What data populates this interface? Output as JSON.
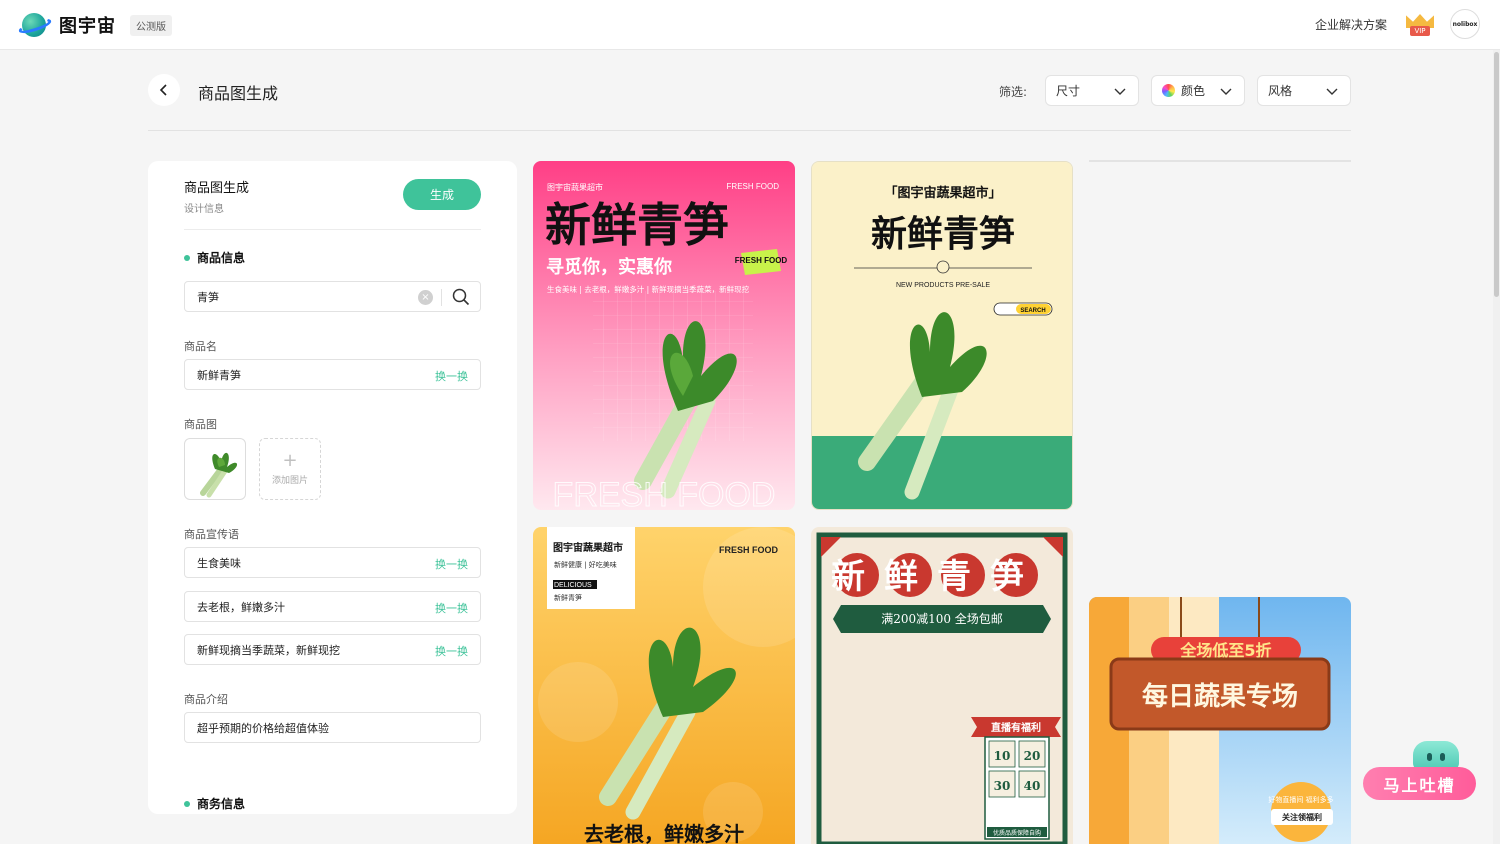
{
  "header": {
    "brand": "图宇宙",
    "beta_badge": "公测版",
    "enterprise_link": "企业解决方案",
    "vip_label": "VIP",
    "avatar_text": "nolibox"
  },
  "page": {
    "title": "商品图生成",
    "filter_label": "筛选:",
    "filters": {
      "size": "尺寸",
      "color": "颜色",
      "style": "风格"
    }
  },
  "form": {
    "title": "商品图生成",
    "subtitle": "设计信息",
    "generate_label": "生成",
    "section_product": "商品信息",
    "search_value": "青笋",
    "name_label": "商品名",
    "name_value": "新鲜青笋",
    "swap_label": "换一换",
    "image_label": "商品图",
    "add_image_label": "添加图片",
    "slogan_label": "商品宣传语",
    "slogans": [
      "生食美味",
      "去老根，鲜嫩多汁",
      "新鲜现摘当季蔬菜，新鲜现挖"
    ],
    "intro_label": "商品介绍",
    "intro_value": "超乎预期的价格给超值体验",
    "section_business": "商务信息"
  },
  "cards": {
    "pink": {
      "store": "图宇宙蔬果超市",
      "fresh": "FRESH FOOD",
      "title": "新鲜青笋",
      "subtitle": "寻觅你，实惠你",
      "badge": "FRESH FOOD",
      "tags": "生食美味 | 去老根，鲜嫩多汁 | 新鲜现摘当季蔬菜，新鲜现挖",
      "watermark": "FRESH FOOD"
    },
    "cream": {
      "store": "「图宇宙蔬果超市」",
      "title": "新鲜青笋",
      "presale": "NEW PRODUCTS PRE-SALE",
      "search": "SEARCH"
    },
    "orange": {
      "store": "图宇宙蔬果超市",
      "slogan": "新鲜健康 | 好吃美味",
      "delicious": "DELICIOUS",
      "product": "新鲜青笋",
      "fresh": "FRESH FOOD",
      "bottom": "去老根，鲜嫩多汁"
    },
    "festive": {
      "title": "新鲜青笋",
      "promo": "满200减100 全场包邮",
      "welfare": "直播有福利",
      "coupons": [
        "10",
        "20",
        "30",
        "40"
      ],
      "footer": "优质品质保障自购"
    },
    "sky": {
      "ribbon": "全场低至5折",
      "board": "每日蔬果专场",
      "stamp": "好物直播间 福利多多",
      "follow": "关注领福利"
    }
  },
  "feedback": {
    "label": "马上吐槽"
  },
  "colors": {
    "accent": "#3fc39a",
    "pink": "#ff4f8b",
    "green": "#3aab79",
    "orange": "#f7b33a"
  },
  "icons": [
    "back-arrow-icon",
    "chevron-down-icon",
    "color-wheel-icon",
    "search-icon",
    "clear-icon",
    "plus-icon",
    "crown-icon"
  ]
}
